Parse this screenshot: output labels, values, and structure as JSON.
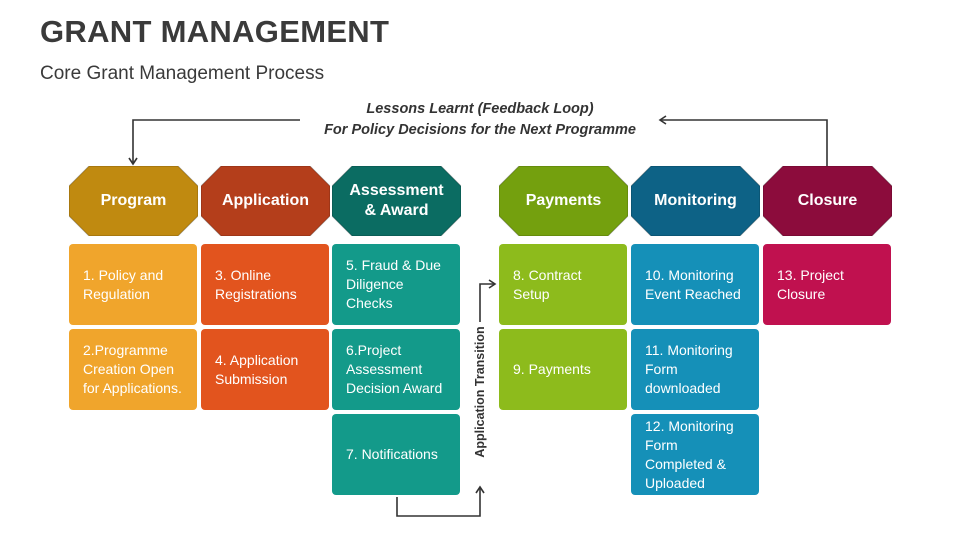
{
  "title": "GRANT MANAGEMENT",
  "subtitle": "Core Grant Management Process",
  "feedback_loop": {
    "line1": "Lessons Learnt (Feedback Loop)",
    "line2": "For Policy Decisions for the Next Programme"
  },
  "transition_label": "Application Transition",
  "stages": [
    {
      "label": "Program",
      "color": "#c08a10",
      "steps": [
        {
          "text": "1. Policy and Regulation",
          "color": "#f0a52c"
        },
        {
          "text": "2.Programme Creation Open for Applications.",
          "color": "#f0a52c"
        }
      ]
    },
    {
      "label": "Application",
      "color": "#b43e1b",
      "steps": [
        {
          "text": "3. Online Registrations",
          "color": "#e2541e"
        },
        {
          "text": "4. Application Submission",
          "color": "#e2541e"
        }
      ]
    },
    {
      "label": "Assessment & Award",
      "color": "#0b6c62",
      "steps": [
        {
          "text": "5. Fraud & Due Diligence Checks",
          "color": "#139a8a"
        },
        {
          "text": "6.Project Assessment Decision Award",
          "color": "#139a8a"
        },
        {
          "text": "7. Notifications",
          "color": "#139a8a"
        }
      ]
    },
    {
      "label": "Payments",
      "color": "#74a00e",
      "steps": [
        {
          "text": "8. Contract Setup",
          "color": "#8dbb1c"
        },
        {
          "text": "9. Payments",
          "color": "#8dbb1c"
        }
      ]
    },
    {
      "label": "Monitoring",
      "color": "#0d6286",
      "steps": [
        {
          "text": "10. Monitoring Event Reached",
          "color": "#1590b8"
        },
        {
          "text": "11. Monitoring Form downloaded",
          "color": "#1590b8"
        },
        {
          "text": "12. Monitoring Form Completed & Uploaded",
          "color": "#1590b8"
        }
      ]
    },
    {
      "label": "Closure",
      "color": "#8c0c3c",
      "steps": [
        {
          "text": "13. Project Closure",
          "color": "#c0114f"
        }
      ]
    }
  ]
}
